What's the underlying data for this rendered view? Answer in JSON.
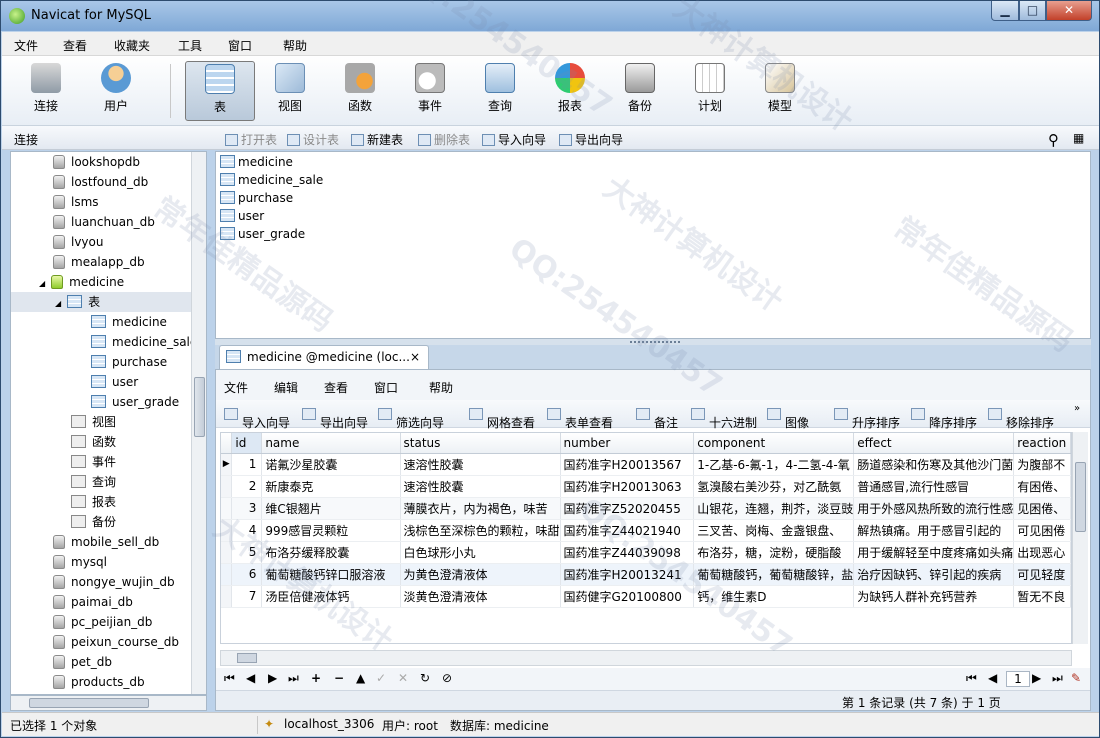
{
  "window": {
    "title": "Navicat for MySQL",
    "min_icon": "minimize-icon",
    "max_icon": "maximize-icon",
    "close_icon": "close-icon"
  },
  "menu": [
    "文件",
    "查看",
    "收藏夹",
    "工具",
    "窗口",
    "帮助"
  ],
  "toolbar": [
    {
      "label": "连接",
      "icon": "connection-icon"
    },
    {
      "label": "用户",
      "icon": "user-icon"
    },
    {
      "label": "表",
      "icon": "table-icon"
    },
    {
      "label": "视图",
      "icon": "view-icon"
    },
    {
      "label": "函数",
      "icon": "function-icon"
    },
    {
      "label": "事件",
      "icon": "event-icon"
    },
    {
      "label": "查询",
      "icon": "query-icon"
    },
    {
      "label": "报表",
      "icon": "report-icon"
    },
    {
      "label": "备份",
      "icon": "backup-icon"
    },
    {
      "label": "计划",
      "icon": "schedule-icon"
    },
    {
      "label": "模型",
      "icon": "model-icon"
    }
  ],
  "subbar": {
    "connection_label": "连接",
    "open": "打开表",
    "design": "设计表",
    "new": "新建表",
    "delete": "删除表",
    "import": "导入向导",
    "export": "导出向导"
  },
  "tree": [
    {
      "label": "lookshopdb",
      "type": "db"
    },
    {
      "label": "lostfound_db",
      "type": "db"
    },
    {
      "label": "lsms",
      "type": "db"
    },
    {
      "label": "luanchuan_db",
      "type": "db"
    },
    {
      "label": "lvyou",
      "type": "db"
    },
    {
      "label": "mealapp_db",
      "type": "db"
    },
    {
      "label": "medicine",
      "type": "db-open"
    },
    {
      "label": "表",
      "type": "group"
    },
    {
      "label": "medicine",
      "type": "table"
    },
    {
      "label": "medicine_sale",
      "type": "table"
    },
    {
      "label": "purchase",
      "type": "table"
    },
    {
      "label": "user",
      "type": "table"
    },
    {
      "label": "user_grade",
      "type": "table"
    },
    {
      "label": "视图",
      "type": "sub"
    },
    {
      "label": "函数",
      "type": "sub"
    },
    {
      "label": "事件",
      "type": "sub"
    },
    {
      "label": "查询",
      "type": "sub"
    },
    {
      "label": "报表",
      "type": "sub"
    },
    {
      "label": "备份",
      "type": "sub"
    },
    {
      "label": "mobile_sell_db",
      "type": "db"
    },
    {
      "label": "mysql",
      "type": "db"
    },
    {
      "label": "nongye_wujin_db",
      "type": "db"
    },
    {
      "label": "paimai_db",
      "type": "db"
    },
    {
      "label": "pc_peijian_db",
      "type": "db"
    },
    {
      "label": "peixun_course_db",
      "type": "db"
    },
    {
      "label": "pet_db",
      "type": "db"
    },
    {
      "label": "products_db",
      "type": "db"
    }
  ],
  "objects": [
    "medicine",
    "medicine_sale",
    "purchase",
    "user",
    "user_grade"
  ],
  "tab": {
    "label": "medicine @medicine (loc...",
    "close": "×"
  },
  "inner_menu": [
    "文件",
    "编辑",
    "查看",
    "窗口",
    "帮助"
  ],
  "inner_toolbar": [
    "导入向导",
    "导出向导",
    "筛选向导",
    "网格查看",
    "表单查看",
    "备注",
    "十六进制",
    "图像",
    "升序排序",
    "降序排序",
    "移除排序"
  ],
  "grid": {
    "columns": [
      "id",
      "name",
      "status",
      "number",
      "component",
      "effect",
      "reaction"
    ],
    "rows": [
      [
        "1",
        "诺氟沙星胶囊",
        "速溶性胶囊",
        "国药准字H20013567",
        "1-乙基-6-氟-1，4-二氢-4-氧",
        "肠道感染和伤寒及其他沙门菌",
        "为腹部不"
      ],
      [
        "2",
        "新康泰克",
        "速溶性胶囊",
        "国药准字H20013063",
        "氢溴酸右美沙芬，对乙酰氨",
        "普通感冒,流行性感冒",
        "有困倦、"
      ],
      [
        "3",
        "维C银翘片",
        "薄膜衣片，内为褐色，味苦",
        "国药准字Z52020455",
        "山银花，连翘，荆芥，淡豆豉",
        "用于外感风热所致的流行性感",
        "见困倦、"
      ],
      [
        "4",
        "999感冒灵颗粒",
        "浅棕色至深棕色的颗粒，味甜",
        "国药准字Z44021940",
        "三叉苦、岗梅、金盏银盘、",
        "解热镇痛。用于感冒引起的",
        "可见困倦"
      ],
      [
        "5",
        "布洛芬缓释胶囊",
        "白色球形小丸",
        "国药准字Z44039098",
        "布洛芬，糖，淀粉，硬脂酸",
        "用于缓解轻至中度疼痛如头痛",
        "出现恶心"
      ],
      [
        "6",
        "葡萄糖酸钙锌口服溶液",
        "为黄色澄清液体",
        "国药准字H20013241",
        "葡萄糖酸钙，葡萄糖酸锌，盐",
        "治疗因缺钙、锌引起的疾病",
        "可见轻度"
      ],
      [
        "7",
        "汤臣倍健液体钙",
        "淡黄色澄清液体",
        "国药健字G20100800",
        "钙，维生素D",
        "为缺钙人群补充钙营养",
        "暂无不良"
      ]
    ]
  },
  "nav": {
    "page": "1"
  },
  "record_status": "第 1 条记录 (共 7 条) 于 1 页",
  "status": {
    "selected": "已选择 1 个对象",
    "connection": "localhost_3306",
    "user": "用户: root",
    "database": "数据库: medicine"
  },
  "watermark": [
    "QQ:254540457",
    "大神计算机设计",
    "常年佳精品源码"
  ]
}
